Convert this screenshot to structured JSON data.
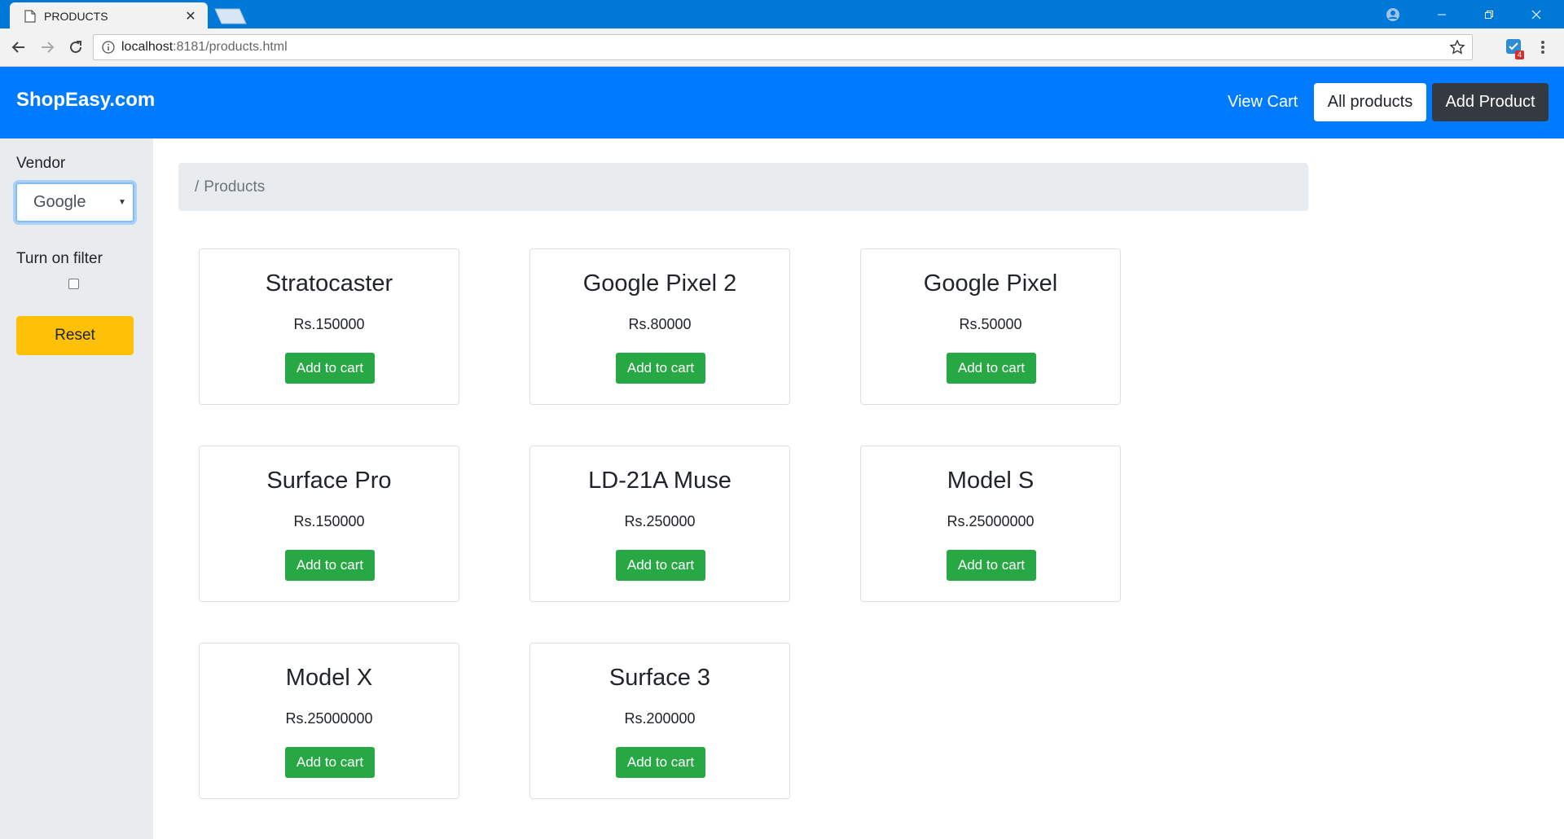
{
  "browser": {
    "tab_title": "PRODUCTS",
    "url_host": "localhost",
    "url_rest": ":8181/products.html",
    "extension_badge": "4"
  },
  "navbar": {
    "brand": "ShopEasy.com",
    "view_cart": "View Cart",
    "all_products": "All products",
    "add_product": "Add Product"
  },
  "sidebar": {
    "vendor_label": "Vendor",
    "vendor_selected": "Google",
    "filter_label": "Turn on filter",
    "filter_checked": false,
    "reset_label": "Reset"
  },
  "breadcrumb": {
    "separator": "/",
    "current": "Products"
  },
  "products": [
    {
      "name": "Stratocaster",
      "price": "Rs.150000",
      "button": "Add to cart"
    },
    {
      "name": "Google Pixel 2",
      "price": "Rs.80000",
      "button": "Add to cart"
    },
    {
      "name": "Google Pixel",
      "price": "Rs.50000",
      "button": "Add to cart"
    },
    {
      "name": "Surface Pro",
      "price": "Rs.150000",
      "button": "Add to cart"
    },
    {
      "name": "LD-21A Muse",
      "price": "Rs.250000",
      "button": "Add to cart"
    },
    {
      "name": "Model S",
      "price": "Rs.25000000",
      "button": "Add to cart"
    },
    {
      "name": "Model X",
      "price": "Rs.25000000",
      "button": "Add to cart"
    },
    {
      "name": "Surface 3",
      "price": "Rs.200000",
      "button": "Add to cart"
    }
  ],
  "colors": {
    "primary": "#007bff",
    "success": "#28a745",
    "warning": "#ffc107",
    "dark": "#343a40",
    "light": "#e9ecef"
  }
}
